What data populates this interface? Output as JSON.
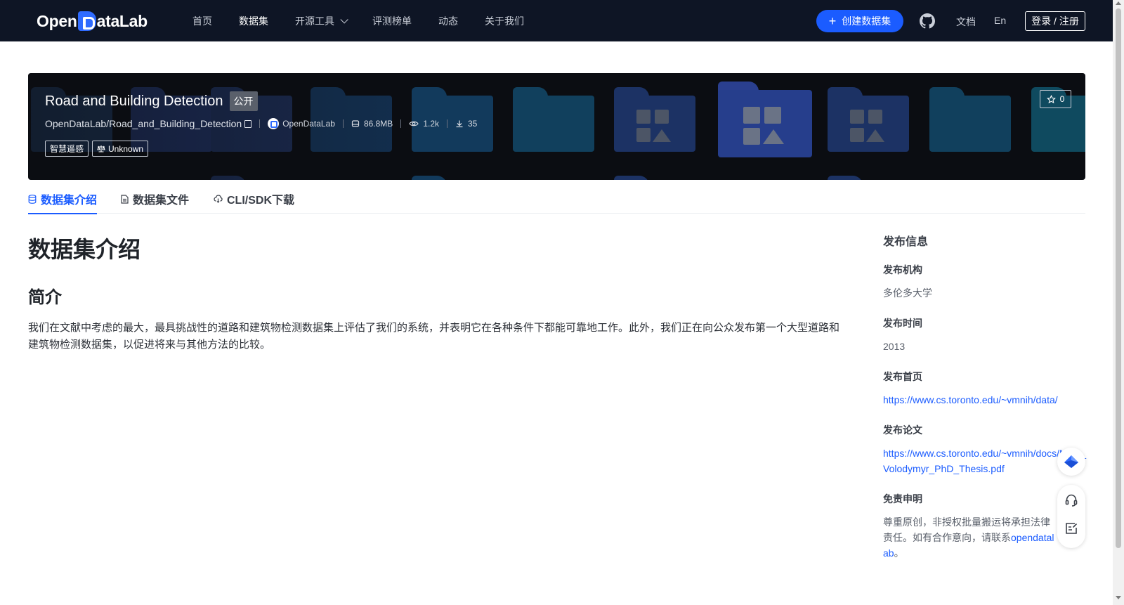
{
  "nav": {
    "logo_part1": "Open",
    "logo_part2": "ataLab",
    "items": [
      {
        "label": "首页"
      },
      {
        "label": "数据集"
      },
      {
        "label": "开源工具"
      },
      {
        "label": "评测榜单"
      },
      {
        "label": "动态"
      },
      {
        "label": "关于我们"
      }
    ],
    "create_label": "创建数据集",
    "docs_label": "文档",
    "lang_label": "En",
    "login_label": "登录 / 注册"
  },
  "dataset": {
    "title": "Road and Building Detection",
    "visibility": "公开",
    "path": "OpenDataLab/Road_and_Building_Detection",
    "org": "OpenDataLab",
    "size": "86.8MB",
    "views": "1.2k",
    "downloads": "35",
    "tags": [
      "智慧遥感",
      "Unknown"
    ],
    "stars": "0"
  },
  "tabs": [
    {
      "label": "数据集介绍"
    },
    {
      "label": "数据集文件"
    },
    {
      "label": "CLI/SDK下载"
    }
  ],
  "content": {
    "heading": "数据集介绍",
    "subheading": "简介",
    "paragraph": "我们在文献中考虑的最大，最具挑战性的道路和建筑物检测数据集上评估了我们的系统，并表明它在各种条件下都能可靠地工作。此外，我们正在向公众发布第一个大型道路和建筑物检测数据集，以促进将来与其他方法的比较。"
  },
  "sidebar": {
    "title": "发布信息",
    "org_label": "发布机构",
    "org_value": "多伦多大学",
    "time_label": "发布时间",
    "time_value": "2013",
    "home_label": "发布首页",
    "home_value": "https://www.cs.toronto.edu/~vmnih/data/",
    "paper_label": "发布论文",
    "paper_value": "https://www.cs.toronto.edu/~vmnih/docs/Mnih_Volodymyr_PhD_Thesis.pdf",
    "disclaimer_label": "免责申明",
    "disclaimer_text": "尊重原创，非授权批量搬运将承担法律责任。如有合作意向，请联系",
    "disclaimer_link": "opendatalab",
    "disclaimer_end": "。"
  },
  "colors": {
    "accent": "#1b5cff",
    "nav_bg": "#0e1525",
    "banner_bg": "#0b0d12"
  }
}
